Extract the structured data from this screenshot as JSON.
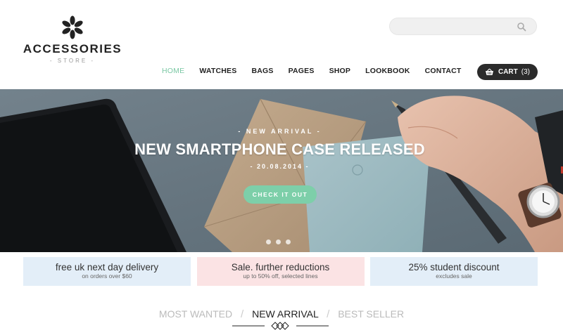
{
  "brand": {
    "name": "ACCESSORIES",
    "tagline": "- STORE -"
  },
  "search": {
    "placeholder": ""
  },
  "nav": {
    "items": [
      {
        "label": "HOME",
        "active": true
      },
      {
        "label": "WATCHES",
        "active": false
      },
      {
        "label": "BAGS",
        "active": false
      },
      {
        "label": "PAGES",
        "active": false
      },
      {
        "label": "SHOP",
        "active": false
      },
      {
        "label": "LOOKBOOK",
        "active": false
      },
      {
        "label": "CONTACT",
        "active": false
      }
    ],
    "active_color": "#7bc8a4"
  },
  "cart": {
    "label": "CART",
    "count": "(3)"
  },
  "hero": {
    "kicker": "- NEW ARRIVAL -",
    "title": "NEW SMARTPHONE CASE RELEASED",
    "date": "- 20.08.2014 -",
    "button": "CHECK IT OUT",
    "button_color": "#7dcfa9",
    "slide_count": 3
  },
  "promos": [
    {
      "title": "free uk next day delivery",
      "subtitle": "on orders over $60",
      "color": "#e3eef8"
    },
    {
      "title": "Sale. further reductions",
      "subtitle": "up to 50% off, selected lines",
      "color": "#fbe3e4"
    },
    {
      "title": "25% student discount",
      "subtitle": "excludes sale",
      "color": "#e3eef8"
    }
  ],
  "tabs": {
    "items": [
      {
        "label": "MOST WANTED",
        "active": false
      },
      {
        "label": "NEW ARRIVAL",
        "active": true
      },
      {
        "label": "BEST SELLER",
        "active": false
      }
    ],
    "separator": "/"
  }
}
